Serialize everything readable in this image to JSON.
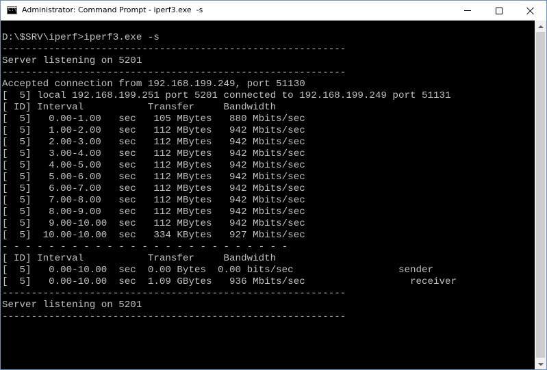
{
  "window": {
    "title": "Administrator: Command Prompt - iperf3.exe  -s",
    "icon": "cmd-icon",
    "icon_text": "C:\\"
  },
  "controls": {
    "minimize": "minimize-icon",
    "maximize": "maximize-icon",
    "close": "close-icon"
  },
  "console": {
    "lines": [
      "",
      "D:\\$SRV\\iperf>iperf3.exe -s",
      "-----------------------------------------------------------",
      "Server listening on 5201",
      "-----------------------------------------------------------",
      "Accepted connection from 192.168.199.249, port 51130",
      "[  5] local 192.168.199.251 port 5201 connected to 192.168.199.249 port 51131",
      "[ ID] Interval           Transfer     Bandwidth",
      "[  5]   0.00-1.00   sec   105 MBytes   880 Mbits/sec",
      "[  5]   1.00-2.00   sec   112 MBytes   942 Mbits/sec",
      "[  5]   2.00-3.00   sec   112 MBytes   942 Mbits/sec",
      "[  5]   3.00-4.00   sec   112 MBytes   942 Mbits/sec",
      "[  5]   4.00-5.00   sec   112 MBytes   942 Mbits/sec",
      "[  5]   5.00-6.00   sec   112 MBytes   942 Mbits/sec",
      "[  5]   6.00-7.00   sec   112 MBytes   942 Mbits/sec",
      "[  5]   7.00-8.00   sec   112 MBytes   942 Mbits/sec",
      "[  5]   8.00-9.00   sec   112 MBytes   942 Mbits/sec",
      "[  5]   9.00-10.00  sec   112 MBytes   942 Mbits/sec",
      "[  5]  10.00-10.00  sec   334 KBytes   927 Mbits/sec",
      "- - - - - - - - - - - - - - - - - - - - - - - - -",
      "[ ID] Interval           Transfer     Bandwidth",
      "[  5]   0.00-10.00  sec  0.00 Bytes  0.00 bits/sec                  sender",
      "[  5]   0.00-10.00  sec  1.09 GBytes   936 Mbits/sec                  receiver",
      "-----------------------------------------------------------",
      "Server listening on 5201",
      "-----------------------------------------------------------"
    ]
  }
}
